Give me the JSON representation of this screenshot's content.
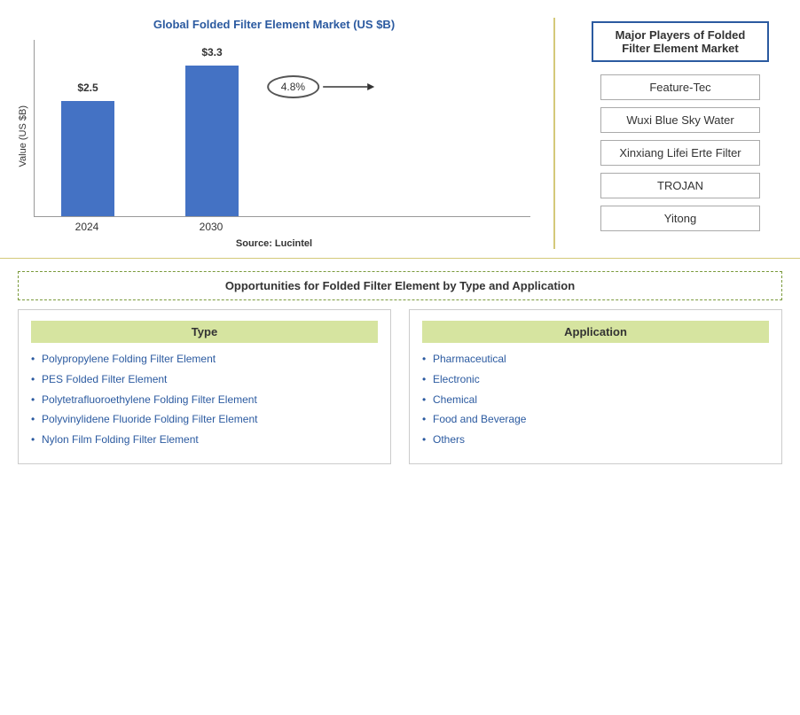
{
  "chart": {
    "title": "Global Folded Filter Element Market (US $B)",
    "y_axis_label": "Value (US $B)",
    "bars": [
      {
        "year": "2024",
        "value": "$2.5",
        "height": 130
      },
      {
        "year": "2030",
        "value": "$3.3",
        "height": 170
      }
    ],
    "cagr_label": "4.8%",
    "source": "Source: Lucintel"
  },
  "players": {
    "title": "Major Players of Folded Filter Element Market",
    "items": [
      "Feature-Tec",
      "Wuxi Blue Sky Water",
      "Xinxiang Lifei Erte Filter",
      "TROJAN",
      "Yitong"
    ]
  },
  "opportunities": {
    "section_title": "Opportunities for Folded Filter Element by Type and Application",
    "type": {
      "header": "Type",
      "items": [
        "Polypropylene Folding Filter Element",
        "PES Folded Filter Element",
        "Polytetrafluoroethylene Folding Filter Element",
        "Polyvinylidene Fluoride Folding Filter Element",
        "Nylon Film Folding Filter Element"
      ]
    },
    "application": {
      "header": "Application",
      "items": [
        "Pharmaceutical",
        "Electronic",
        "Chemical",
        "Food and Beverage",
        "Others"
      ]
    }
  }
}
